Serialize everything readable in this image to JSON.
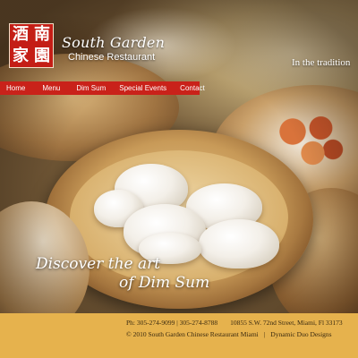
{
  "logo": {
    "chars": [
      "酒",
      "南",
      "家",
      "園"
    ]
  },
  "brand": {
    "name": "South Garden",
    "subtitle": "Chinese Restaurant"
  },
  "tagline": "In the tradition",
  "nav": {
    "items": [
      "Home",
      "Menu",
      "Dim Sum",
      "Special Events",
      "Contact"
    ]
  },
  "hero": {
    "headline_line1": "Discover the art",
    "headline_line2": "of Dim Sum"
  },
  "footer": {
    "phone": "Ph: 305-274-9099 | 305-274-8788",
    "address": "10855 S.W. 72nd Street, Miami, Fl 33173",
    "copyright": "© 2010 South Garden Chinese Restaurant Miami",
    "separator": "|",
    "credit": "Dynamic Duo Designs"
  },
  "colors": {
    "nav_background": "#c9221a",
    "logo_background": "#c41e16",
    "footer_background": "#e6b24d"
  }
}
